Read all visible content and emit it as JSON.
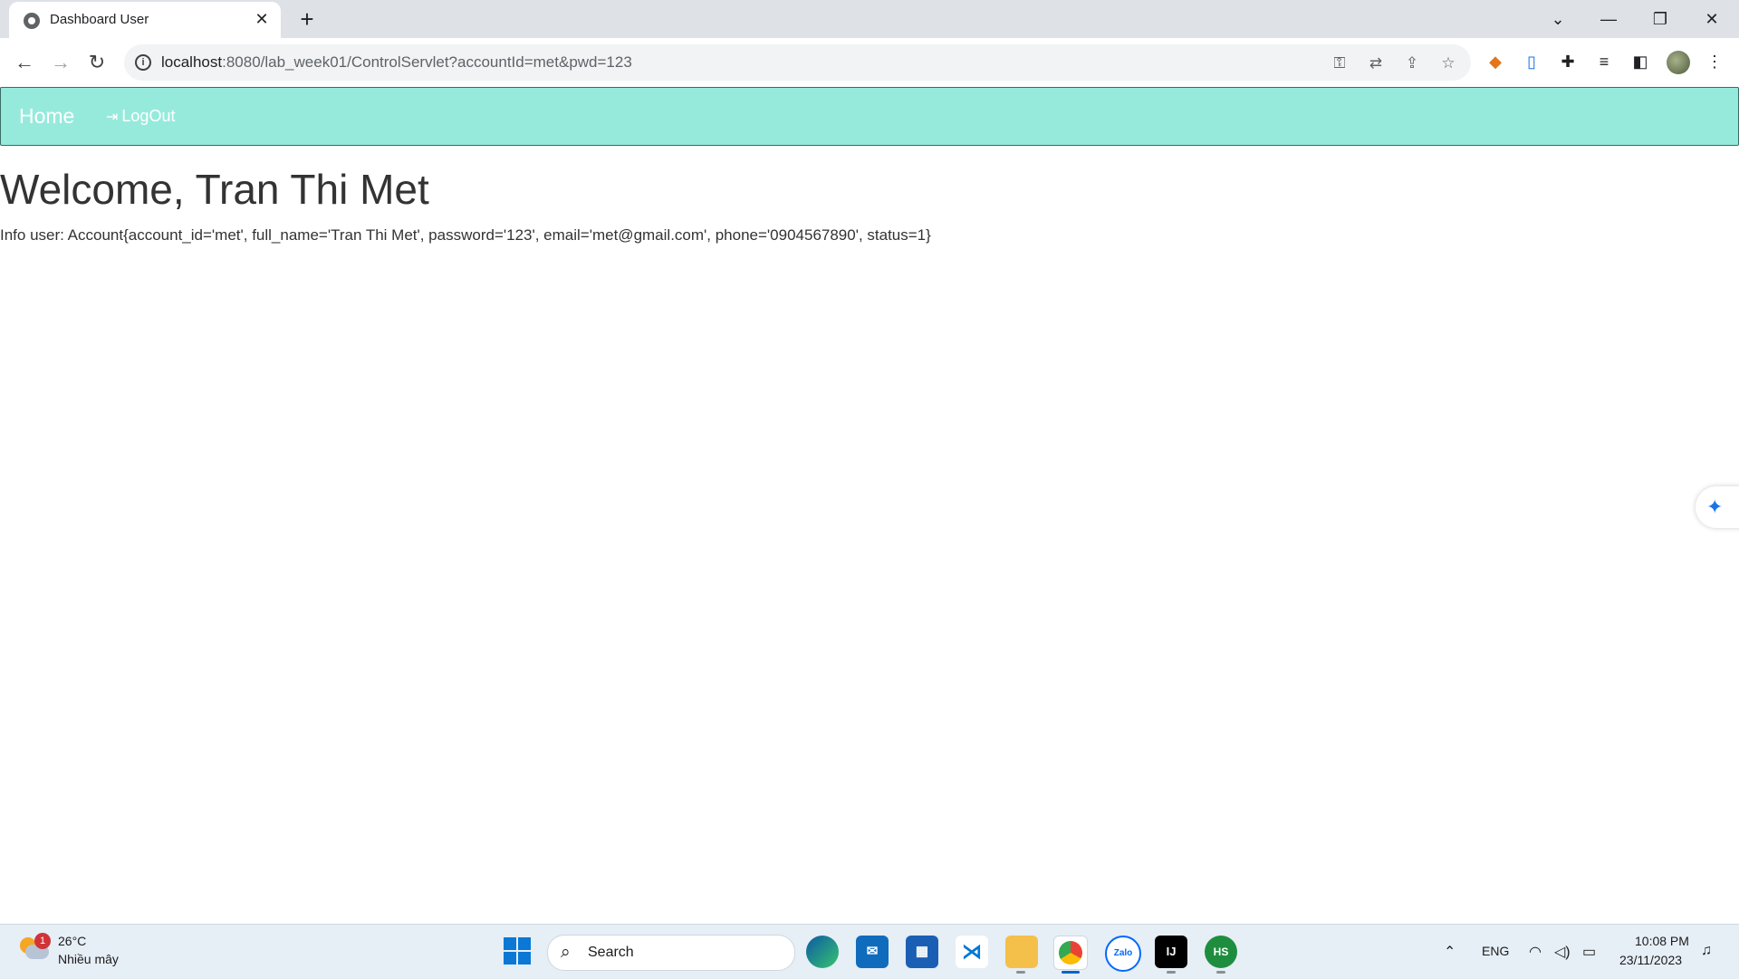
{
  "browser": {
    "tab_title": "Dashboard User",
    "tab_close": "✕",
    "new_tab": "+",
    "url_host": "localhost",
    "url_rest": ":8080/lab_week01/ControlServlet?accountId=met&pwd=123",
    "window_controls": {
      "list": "⌄",
      "minimize": "—",
      "restore": "❐",
      "close": "✕"
    }
  },
  "page": {
    "nav": {
      "home": "Home",
      "logout": "LogOut"
    },
    "welcome": "Welcome, Tran Thi Met",
    "info": "Info user: Account{account_id='met', full_name='Tran Thi Met', password='123', email='met@gmail.com', phone='0904567890', status=1}"
  },
  "taskbar": {
    "weather": {
      "badge": "1",
      "temp": "26°C",
      "desc": "Nhiều mây"
    },
    "search_label": "Search",
    "apps": [
      "edge-icon",
      "mail-icon",
      "store-icon",
      "vscode-icon",
      "file-explorer-icon",
      "chrome-icon",
      "zalo-icon",
      "intellij-icon",
      "hs-icon"
    ],
    "zalo_label": "Zalo",
    "intellij_label": "IJ",
    "hs_label": "HS",
    "language": "ENG",
    "time": "10:08 PM",
    "date": "23/11/2023"
  },
  "colors": {
    "navbar_bg": "#96eadc",
    "text": "#333333"
  }
}
